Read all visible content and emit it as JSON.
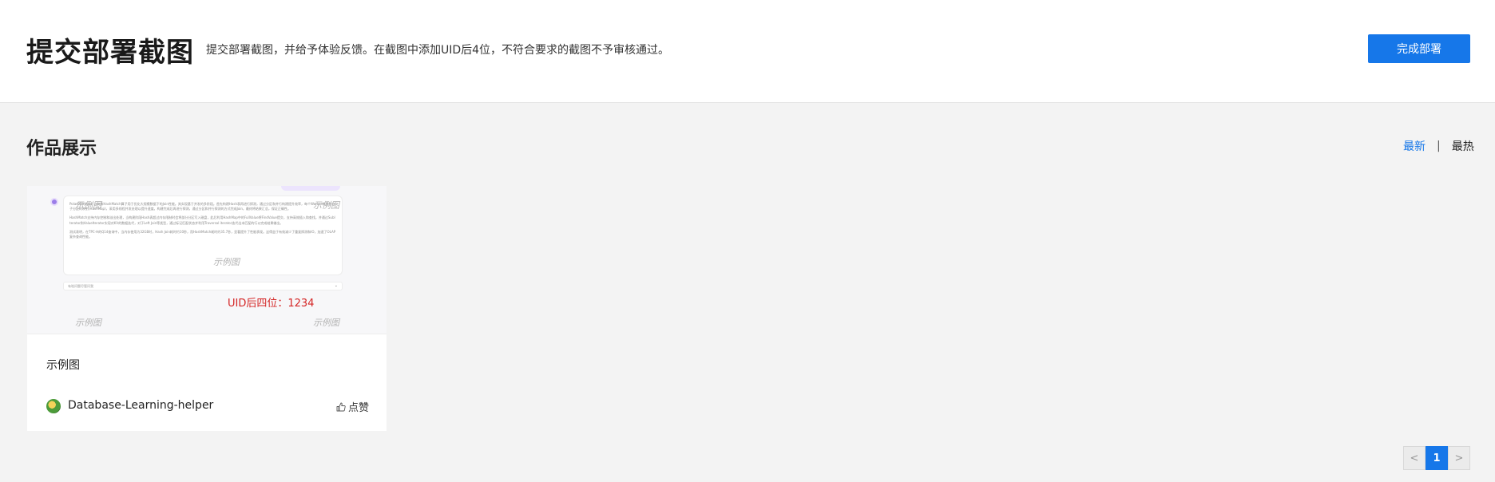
{
  "header": {
    "title": "提交部署截图",
    "description": "提交部署截图，并给予体验反馈。在截图中添加UID后4位，不符合要求的截图不予审核通过。",
    "done_button": "完成部署"
  },
  "gallery": {
    "title": "作品展示",
    "sort_latest": "最新",
    "sort_separator": "|",
    "sort_hot": "最热"
  },
  "card": {
    "watermark": "示例图",
    "uid_label": "UID后四位：1234",
    "thumbnail_paragraphs": [
      "PolarDB的Hash Join和HashMatch算子用于优化大规模数据下的Join性能。其实现基于并发的多阶段。首先构建Hash表再进行探测，通过分区和并行构建提升效率，每个Worker构建各自子分区的映射(HashMap)，采用多线程并发处理以提升速度。构建完成后再进行探测，通过分区和并行探测的方式完成Join，最终将结果汇总，保证正确性。",
      "HashMatch支持内存控制和溢出处理，当构建阶段Hash表超过内存限制时会将部分分区写入磁盘，此后利用HashMap中的FullValue将FindValue提交，支持高效插入和查找。并通过SubIterator和ValueIterator实现对KV的数据迭代，对于Left Join等类型，通过标记匹配状态并利用Traversal iterator迭代出未匹配的行以完成结果输出。",
      "测试表明，在TPC-H的Q14查询中，当内存使用为32GB时，Hash Join耗时约10秒，而HashMatch耗时约35.7秒，显著提升了性能表现。这得益于有效减少了重复探测和IO，加速了OLAP复杂查询性能。"
    ],
    "thumbnail_input": "有啥问题尽管问我",
    "name": "示例图",
    "author": "Database-Learning-helper",
    "like_label": "点赞"
  },
  "pagination": {
    "prev": "<",
    "current": "1",
    "next": ">"
  },
  "colors": {
    "accent": "#1677e9",
    "uid_red": "#d42424",
    "page_bg": "#f3f3f3"
  },
  "icons": {
    "like": "thumb-up-icon",
    "avatar": "author-avatar",
    "chat_dot": "assistant-dot-icon"
  }
}
